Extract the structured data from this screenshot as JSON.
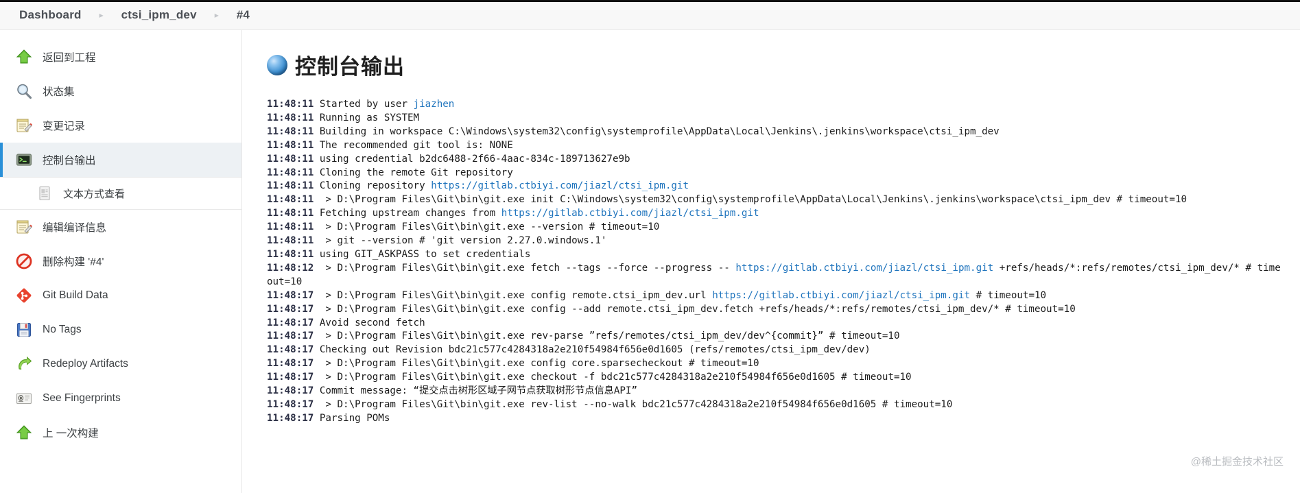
{
  "breadcrumb": {
    "items": [
      "Dashboard",
      "ctsi_ipm_dev",
      "#4"
    ],
    "separator": "▸"
  },
  "sidebar": {
    "items": [
      {
        "label": "返回到工程",
        "icon": "up-arrow-icon",
        "selected": false,
        "sub": false
      },
      {
        "label": "状态集",
        "icon": "magnifier-icon",
        "selected": false,
        "sub": false
      },
      {
        "label": "变更记录",
        "icon": "notepad-pencil-icon",
        "selected": false,
        "sub": false
      },
      {
        "label": "控制台输出",
        "icon": "terminal-icon",
        "selected": true,
        "sub": false
      },
      {
        "label": "文本方式查看",
        "icon": "document-icon",
        "selected": false,
        "sub": true
      },
      {
        "label": "编辑编译信息",
        "icon": "notepad-pencil-icon",
        "selected": false,
        "sub": false
      },
      {
        "label": "删除构建 '#4'",
        "icon": "no-entry-icon",
        "selected": false,
        "sub": false
      },
      {
        "label": "Git Build Data",
        "icon": "git-icon",
        "selected": false,
        "sub": false
      },
      {
        "label": "No Tags",
        "icon": "floppy-disk-icon",
        "selected": false,
        "sub": false
      },
      {
        "label": "Redeploy Artifacts",
        "icon": "redeploy-arrow-icon",
        "selected": false,
        "sub": false
      },
      {
        "label": "See Fingerprints",
        "icon": "fingerprint-card-icon",
        "selected": false,
        "sub": false
      },
      {
        "label": "上 一次构建",
        "icon": "up-arrow-icon",
        "selected": false,
        "sub": false
      }
    ]
  },
  "main": {
    "title": "控制台输出",
    "title_icon": "blue-build-ball-icon",
    "watermark": "@稀土掘金技术社区",
    "console_lines": [
      {
        "ts": "11:48:11",
        "parts": [
          {
            "t": "text",
            "v": "Started by user "
          },
          {
            "t": "link",
            "v": "jiazhen"
          }
        ]
      },
      {
        "ts": "11:48:11",
        "parts": [
          {
            "t": "text",
            "v": "Running as SYSTEM"
          }
        ]
      },
      {
        "ts": "11:48:11",
        "parts": [
          {
            "t": "text",
            "v": "Building in workspace C:\\Windows\\system32\\config\\systemprofile\\AppData\\Local\\Jenkins\\.jenkins\\workspace\\ctsi_ipm_dev"
          }
        ]
      },
      {
        "ts": "11:48:11",
        "parts": [
          {
            "t": "text",
            "v": "The recommended git tool is: NONE"
          }
        ]
      },
      {
        "ts": "11:48:11",
        "parts": [
          {
            "t": "text",
            "v": "using credential b2dc6488-2f66-4aac-834c-189713627e9b"
          }
        ]
      },
      {
        "ts": "11:48:11",
        "parts": [
          {
            "t": "text",
            "v": "Cloning the remote Git repository"
          }
        ]
      },
      {
        "ts": "11:48:11",
        "parts": [
          {
            "t": "text",
            "v": "Cloning repository "
          },
          {
            "t": "link",
            "v": "https://gitlab.ctbiyi.com/jiazl/ctsi_ipm.git"
          }
        ]
      },
      {
        "ts": "11:48:11",
        "parts": [
          {
            "t": "text",
            "v": " > D:\\Program Files\\Git\\bin\\git.exe init C:\\Windows\\system32\\config\\systemprofile\\AppData\\Local\\Jenkins\\.jenkins\\workspace\\ctsi_ipm_dev # timeout=10"
          }
        ]
      },
      {
        "ts": "11:48:11",
        "parts": [
          {
            "t": "text",
            "v": "Fetching upstream changes from "
          },
          {
            "t": "link",
            "v": "https://gitlab.ctbiyi.com/jiazl/ctsi_ipm.git"
          }
        ]
      },
      {
        "ts": "11:48:11",
        "parts": [
          {
            "t": "text",
            "v": " > D:\\Program Files\\Git\\bin\\git.exe --version # timeout=10"
          }
        ]
      },
      {
        "ts": "11:48:11",
        "parts": [
          {
            "t": "text",
            "v": " > git --version # 'git version 2.27.0.windows.1'"
          }
        ]
      },
      {
        "ts": "11:48:11",
        "parts": [
          {
            "t": "text",
            "v": "using GIT_ASKPASS to set credentials"
          }
        ]
      },
      {
        "ts": "11:48:12",
        "parts": [
          {
            "t": "text",
            "v": " > D:\\Program Files\\Git\\bin\\git.exe fetch --tags --force --progress -- "
          },
          {
            "t": "link",
            "v": "https://gitlab.ctbiyi.com/jiazl/ctsi_ipm.git"
          },
          {
            "t": "text",
            "v": " +refs/heads/*:refs/remotes/ctsi_ipm_dev/* # timeout=10"
          }
        ]
      },
      {
        "ts": "11:48:17",
        "parts": [
          {
            "t": "text",
            "v": " > D:\\Program Files\\Git\\bin\\git.exe config remote.ctsi_ipm_dev.url "
          },
          {
            "t": "link",
            "v": "https://gitlab.ctbiyi.com/jiazl/ctsi_ipm.git"
          },
          {
            "t": "text",
            "v": " # timeout=10"
          }
        ]
      },
      {
        "ts": "11:48:17",
        "parts": [
          {
            "t": "text",
            "v": " > D:\\Program Files\\Git\\bin\\git.exe config --add remote.ctsi_ipm_dev.fetch +refs/heads/*:refs/remotes/ctsi_ipm_dev/* # timeout=10"
          }
        ]
      },
      {
        "ts": "11:48:17",
        "parts": [
          {
            "t": "text",
            "v": "Avoid second fetch"
          }
        ]
      },
      {
        "ts": "11:48:17",
        "parts": [
          {
            "t": "text",
            "v": " > D:\\Program Files\\Git\\bin\\git.exe rev-parse ”refs/remotes/ctsi_ipm_dev/dev^{commit}” # timeout=10"
          }
        ]
      },
      {
        "ts": "11:48:17",
        "parts": [
          {
            "t": "text",
            "v": "Checking out Revision bdc21c577c4284318a2e210f54984f656e0d1605 (refs/remotes/ctsi_ipm_dev/dev)"
          }
        ]
      },
      {
        "ts": "11:48:17",
        "parts": [
          {
            "t": "text",
            "v": " > D:\\Program Files\\Git\\bin\\git.exe config core.sparsecheckout # timeout=10"
          }
        ]
      },
      {
        "ts": "11:48:17",
        "parts": [
          {
            "t": "text",
            "v": " > D:\\Program Files\\Git\\bin\\git.exe checkout -f bdc21c577c4284318a2e210f54984f656e0d1605 # timeout=10"
          }
        ]
      },
      {
        "ts": "11:48:17",
        "parts": [
          {
            "t": "text",
            "v": "Commit message: “提交点击树形区域子网节点获取树形节点信息API”"
          }
        ]
      },
      {
        "ts": "11:48:17",
        "parts": [
          {
            "t": "text",
            "v": " > D:\\Program Files\\Git\\bin\\git.exe rev-list --no-walk bdc21c577c4284318a2e210f54984f656e0d1605 # timeout=10"
          }
        ]
      },
      {
        "ts": "11:48:17",
        "parts": [
          {
            "t": "text",
            "v": "Parsing POMs"
          }
        ]
      }
    ]
  }
}
